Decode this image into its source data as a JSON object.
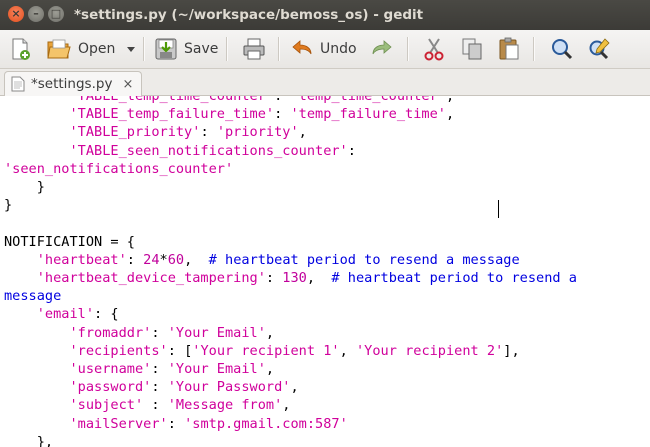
{
  "window": {
    "title": "*settings.py (~/workspace/bemoss_os) - gedit",
    "controls": {
      "close": "×",
      "minimize": "–",
      "maximize": "□"
    }
  },
  "toolbar": {
    "new_icon": "new-document-icon",
    "open_label": "Open",
    "open_icon": "open-folder-icon",
    "open_dropdown_icon": "chevron-down-icon",
    "save_label": "Save",
    "save_icon": "save-icon",
    "print_icon": "print-icon",
    "undo_label": "Undo",
    "undo_icon": "undo-arrow-icon",
    "redo_icon": "redo-arrow-icon",
    "cut_icon": "scissors-icon",
    "copy_icon": "copy-icon",
    "paste_icon": "clipboard-icon",
    "find_icon": "magnifier-icon",
    "replace_icon": "find-replace-icon"
  },
  "tabs": [
    {
      "label": "*settings.py",
      "close": "×"
    }
  ],
  "colors": {
    "string": "#d0009b",
    "comment": "#0000e0",
    "number": "#c0009b",
    "titlebar": "#3c3b37",
    "close_button": "#e0501e"
  },
  "editor": {
    "lines": [
      [
        {
          "t": "        "
        },
        {
          "t": "'TABLE_temp_time_counter'",
          "k": "s"
        },
        {
          "t": ": "
        },
        {
          "t": "'temp_time_counter'",
          "k": "s"
        },
        {
          "t": ","
        }
      ],
      [
        {
          "t": "        "
        },
        {
          "t": "'TABLE_temp_failure_time'",
          "k": "s"
        },
        {
          "t": ": "
        },
        {
          "t": "'temp_failure_time'",
          "k": "s"
        },
        {
          "t": ","
        }
      ],
      [
        {
          "t": "        "
        },
        {
          "t": "'TABLE_priority'",
          "k": "s"
        },
        {
          "t": ": "
        },
        {
          "t": "'priority'",
          "k": "s"
        },
        {
          "t": ","
        }
      ],
      [
        {
          "t": "        "
        },
        {
          "t": "'TABLE_seen_notifications_counter'",
          "k": "s"
        },
        {
          "t": ":"
        }
      ],
      [
        {
          "t": "'seen_notifications_counter'",
          "k": "s"
        }
      ],
      [
        {
          "t": "    }"
        }
      ],
      [
        {
          "t": "}"
        }
      ],
      [
        {
          "t": ""
        }
      ],
      [
        {
          "t": "NOTIFICATION = {"
        }
      ],
      [
        {
          "t": "    "
        },
        {
          "t": "'heartbeat'",
          "k": "s"
        },
        {
          "t": ": "
        },
        {
          "t": "24",
          "k": "n"
        },
        {
          "t": "*"
        },
        {
          "t": "60",
          "k": "n"
        },
        {
          "t": ",  "
        },
        {
          "t": "# heartbeat period to resend a message",
          "k": "c"
        }
      ],
      [
        {
          "t": "    "
        },
        {
          "t": "'heartbeat_device_tampering'",
          "k": "s"
        },
        {
          "t": ": "
        },
        {
          "t": "130",
          "k": "n"
        },
        {
          "t": ",  "
        },
        {
          "t": "# heartbeat period to resend a",
          "k": "c"
        }
      ],
      [
        {
          "t": "message",
          "k": "c"
        }
      ],
      [
        {
          "t": "    "
        },
        {
          "t": "'email'",
          "k": "s"
        },
        {
          "t": ": {"
        }
      ],
      [
        {
          "t": "        "
        },
        {
          "t": "'fromaddr'",
          "k": "s"
        },
        {
          "t": ": "
        },
        {
          "t": "'Your Email'",
          "k": "s"
        },
        {
          "t": ","
        }
      ],
      [
        {
          "t": "        "
        },
        {
          "t": "'recipients'",
          "k": "s"
        },
        {
          "t": ": ["
        },
        {
          "t": "'Your recipient 1'",
          "k": "s"
        },
        {
          "t": ", "
        },
        {
          "t": "'Your recipient 2'",
          "k": "s"
        },
        {
          "t": "],"
        }
      ],
      [
        {
          "t": "        "
        },
        {
          "t": "'username'",
          "k": "s"
        },
        {
          "t": ": "
        },
        {
          "t": "'Your Email'",
          "k": "s"
        },
        {
          "t": ","
        }
      ],
      [
        {
          "t": "        "
        },
        {
          "t": "'password'",
          "k": "s"
        },
        {
          "t": ": "
        },
        {
          "t": "'Your Password'",
          "k": "s"
        },
        {
          "t": ","
        }
      ],
      [
        {
          "t": "        "
        },
        {
          "t": "'subject'",
          "k": "s"
        },
        {
          "t": " : "
        },
        {
          "t": "'Message from'",
          "k": "s"
        },
        {
          "t": ","
        }
      ],
      [
        {
          "t": "        "
        },
        {
          "t": "'mailServer'",
          "k": "s"
        },
        {
          "t": ": "
        },
        {
          "t": "'smtp.gmail.com:587'",
          "k": "s"
        }
      ],
      [
        {
          "t": "    },"
        }
      ]
    ]
  }
}
